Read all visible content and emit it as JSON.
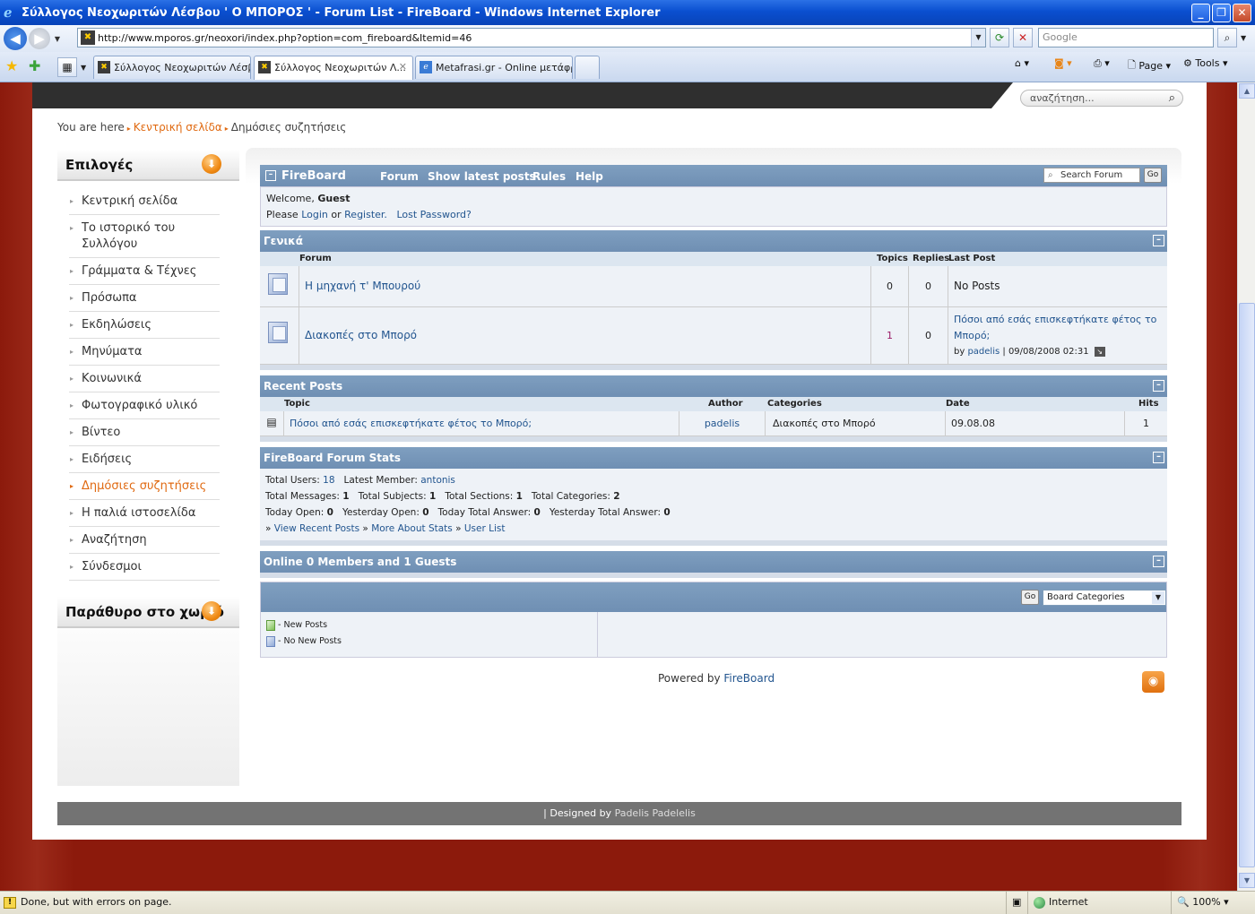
{
  "window": {
    "title": "Σύλλογος Νεοχωριτών Λέσβου ' Ο ΜΠΟΡΟΣ ' - Forum List - FireBoard - Windows Internet Explorer"
  },
  "address": {
    "url": "http://www.mporos.gr/neoxori/index.php?option=com_fireboard&Itemid=46",
    "search_placeholder": "Google"
  },
  "tabs": [
    {
      "label": "Σύλλογος Νεοχωριτών Λέσβ...",
      "active": false
    },
    {
      "label": "Σύλλογος Νεοχωριτών Λ...",
      "active": true
    },
    {
      "label": "Metafrasi.gr - Online μετάφρ...",
      "active": false
    }
  ],
  "commandbar": {
    "page_label": "Page",
    "tools_label": "Tools"
  },
  "site": {
    "search_placeholder": "αναζήτηση...",
    "breadcrumb": {
      "prefix": "You are here",
      "home": "Κεντρική σελίδα",
      "current": "Δημόσιες συζητήσεις"
    }
  },
  "sidebar": {
    "options_title": "Επιλογές",
    "window_title": "Παράθυρο στο χωριό",
    "items": [
      {
        "label": "Κεντρική σελίδα",
        "active": false
      },
      {
        "label": "Το ιστορικό του Συλλόγου",
        "active": false
      },
      {
        "label": "Γράμματα & Τέχνες",
        "active": false
      },
      {
        "label": "Πρόσωπα",
        "active": false
      },
      {
        "label": "Εκδηλώσεις",
        "active": false
      },
      {
        "label": "Μηνύματα",
        "active": false
      },
      {
        "label": "Κοινωνικά",
        "active": false
      },
      {
        "label": "Φωτογραφικό υλικό",
        "active": false
      },
      {
        "label": "Βίντεο",
        "active": false
      },
      {
        "label": "Ειδήσεις",
        "active": false
      },
      {
        "label": "Δημόσιες συζητήσεις",
        "active": true
      },
      {
        "label": "Η παλιά ιστοσελίδα",
        "active": false
      },
      {
        "label": "Αναζήτηση",
        "active": false
      },
      {
        "label": "Σύνδεσμοι",
        "active": false
      }
    ]
  },
  "fireboard": {
    "brand": "FireBoard",
    "nav": [
      "Forum",
      "Show latest posts",
      "Rules",
      "Help"
    ],
    "search_placeholder": "Search Forum",
    "go": "Go",
    "welcome": "Welcome,",
    "user": "Guest",
    "please": "Please",
    "login": "Login",
    "or": "or",
    "register": "Register.",
    "lost_password": "Lost Password?"
  },
  "category": {
    "title": "Γενικά",
    "headers": {
      "forum": "Forum",
      "topics": "Topics",
      "replies": "Replies",
      "last_post": "Last Post"
    },
    "forums": [
      {
        "name": "Η μηχανή τ' Μπουρού",
        "topics": "0",
        "replies": "0",
        "last_post": "No Posts",
        "by": "",
        "author": "",
        "date": ""
      },
      {
        "name": "Διακοπές στο Μπορό",
        "topics": "1",
        "replies": "0",
        "last_post": "Πόσοι από εσάς επισκεφτήκατε φέτος το Μπορό;",
        "by": "by",
        "author": "padelis",
        "date": "| 09/08/2008 02:31"
      }
    ]
  },
  "recent": {
    "title": "Recent Posts",
    "headers": {
      "topic": "Topic",
      "author": "Author",
      "categories": "Categories",
      "date": "Date",
      "hits": "Hits"
    },
    "rows": [
      {
        "topic": "Πόσοι από εσάς επισκεφτήκατε φέτος το Μπορό;",
        "author": "padelis",
        "category": "Διακοπές στο Μπορό",
        "date": "09.08.08",
        "hits": "1"
      }
    ]
  },
  "stats": {
    "title": "FireBoard Forum Stats",
    "total_users_label": "Total Users:",
    "total_users": "18",
    "latest_member_label": "Latest Member:",
    "latest_member": "antonis",
    "total_messages_label": "Total Messages:",
    "total_messages": "1",
    "total_subjects_label": "Total Subjects:",
    "total_subjects": "1",
    "total_sections_label": "Total Sections:",
    "total_sections": "1",
    "total_categories_label": "Total Categories:",
    "total_categories": "2",
    "today_open_label": "Today Open:",
    "today_open": "0",
    "yesterday_open_label": "Yesterday Open:",
    "yesterday_open": "0",
    "today_answer_label": "Today Total Answer:",
    "today_answer": "0",
    "yesterday_answer_label": "Yesterday Total Answer:",
    "yesterday_answer": "0",
    "link_recent": "View Recent Posts",
    "link_more": "More About Stats",
    "link_users": "User List"
  },
  "online": {
    "title": "Online 0 Members and 1 Guests"
  },
  "legend": {
    "go": "Go",
    "select_value": "Board Categories",
    "new_posts": "- New Posts",
    "no_new_posts": "- No New Posts"
  },
  "powered": {
    "prefix": "Powered by",
    "link": "FireBoard"
  },
  "footer": {
    "prefix": "| Designed by",
    "name": "Padelis Padelelis"
  },
  "status": {
    "message": "Done, but with errors on page.",
    "zone": "Internet",
    "zoom": "100%"
  },
  "colors": {
    "accent_orange": "#e06a12",
    "forum_header_blue": "#7f9fc0",
    "link_blue": "#22558f",
    "background_red": "#8c1a0c"
  }
}
